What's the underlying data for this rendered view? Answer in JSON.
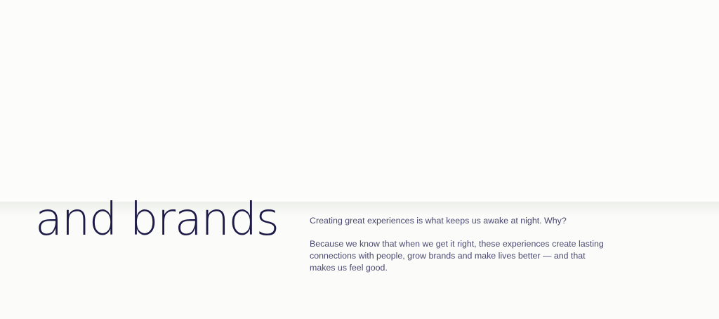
{
  "hero": {
    "headline": "and brands"
  },
  "intro": {
    "paragraph_1": "Creating great experiences is what keeps us awake at night. Why?",
    "paragraph_2": "Because we know that when we get it right, these experiences create lasting connections with people, grow brands and make lives better — and that makes us feel good."
  },
  "colors": {
    "background": "#fbfcf9",
    "headline": "#1d1a48",
    "body_text": "#4a4870"
  }
}
